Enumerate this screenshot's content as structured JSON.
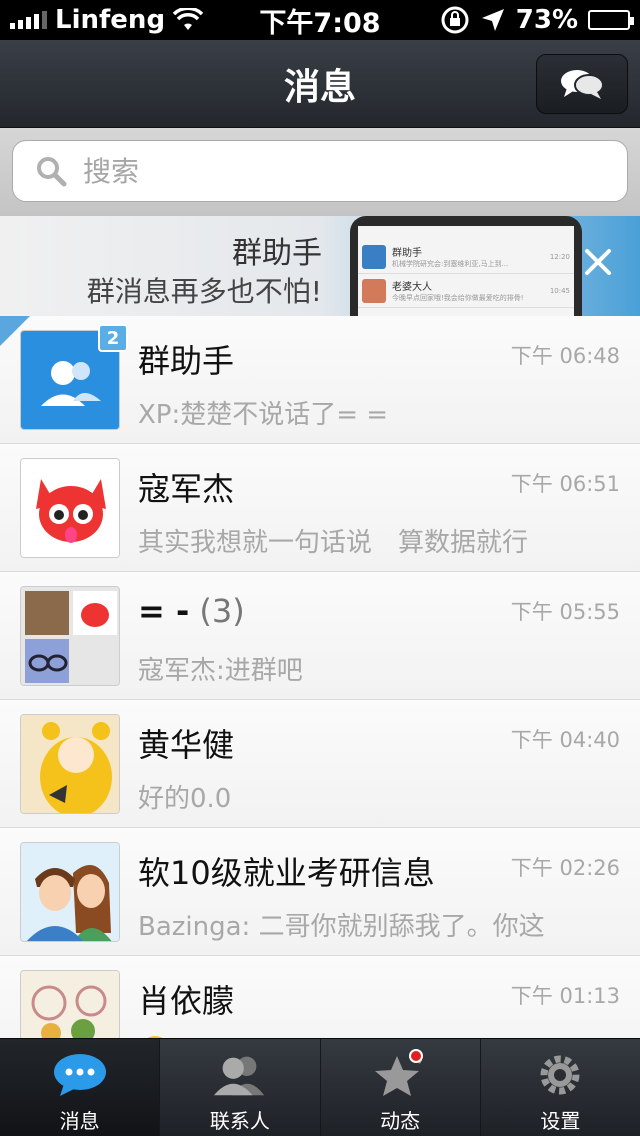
{
  "status_bar": {
    "carrier": "Linfeng",
    "time": "下午7:08",
    "battery": "73%",
    "battery_level": 0.73
  },
  "nav": {
    "title": "消息",
    "right_icon": "chat-bubbles-icon"
  },
  "search": {
    "placeholder": "搜索"
  },
  "banner": {
    "title": "群助手",
    "subtitle": "群消息再多也不怕!",
    "phone_rows": [
      {
        "title": "群助手",
        "badge": "12",
        "subtitle": "机械学院研究会:到塞维利亚,马上到...",
        "time": "12:20"
      },
      {
        "title": "老婆大人",
        "badge": "3",
        "subtitle": "今晚早点回家哦!我会给你做最爱吃的排骨!",
        "time": "10:45"
      }
    ]
  },
  "conversations": [
    {
      "name": "群助手",
      "count": "",
      "time": "下午 06:48",
      "preview": "XP:楚楚不说话了= =",
      "badge": "2",
      "avatar": "group-assistant-avatar"
    },
    {
      "name": "寇军杰",
      "count": "",
      "time": "下午 06:51",
      "preview": "其实我想就一句话说　算数据就行",
      "badge": "",
      "avatar": "red-fox-avatar"
    },
    {
      "name": "= -",
      "count": "(3)",
      "time": "下午 05:55",
      "preview": "寇军杰:进群吧",
      "badge": "",
      "avatar": "group-collage-avatar"
    },
    {
      "name": "黄华健",
      "count": "",
      "time": "下午 04:40",
      "preview": "好的0.0",
      "badge": "",
      "avatar": "anime-girl-avatar"
    },
    {
      "name": "软10级就业考研信息",
      "count": "",
      "time": "下午 02:26",
      "preview": "Bazinga: 二哥你就别舔我了。你这",
      "badge": "",
      "avatar": "couple-avatar"
    },
    {
      "name": "肖依朦",
      "count": "",
      "time": "下午 01:13",
      "preview": "",
      "badge": "",
      "avatar": "flowers-avatar"
    }
  ],
  "tabs": [
    {
      "label": "消息",
      "icon": "chat-bubble-icon",
      "active": true
    },
    {
      "label": "联系人",
      "icon": "contacts-icon",
      "active": false
    },
    {
      "label": "动态",
      "icon": "star-icon",
      "active": false
    },
    {
      "label": "设置",
      "icon": "gear-icon",
      "active": false
    }
  ],
  "colors": {
    "accent": "#2b8fe0",
    "badge": "#5aaee6",
    "notification_dot": "#e02020"
  }
}
